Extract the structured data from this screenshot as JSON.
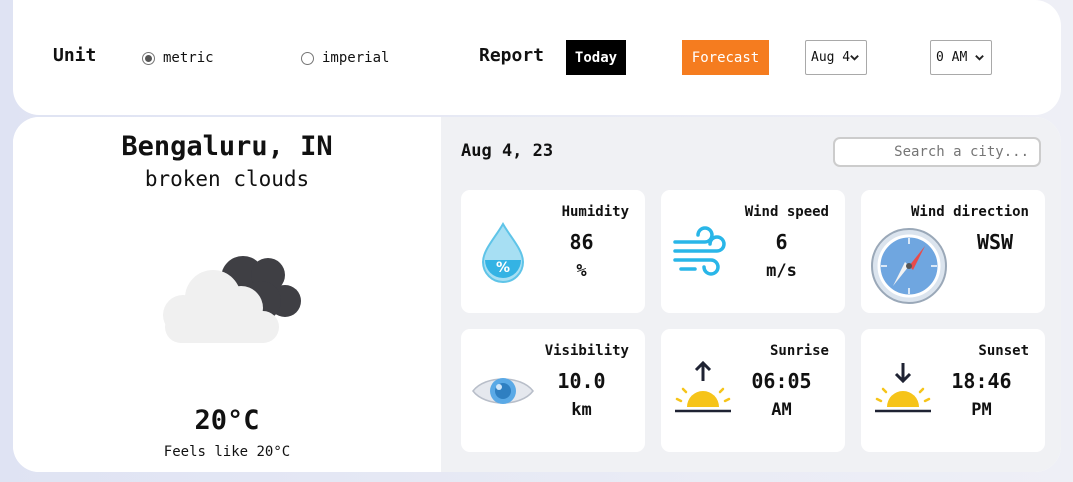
{
  "controls": {
    "unit_label": "Unit",
    "unit_options": [
      {
        "label": "metric",
        "checked": true
      },
      {
        "label": "imperial",
        "checked": false
      }
    ],
    "report_label": "Report",
    "today_label": "Today",
    "forecast_label": "Forecast",
    "date_select": "Aug 4",
    "hour_select": "0 AM"
  },
  "current": {
    "city": "Bengaluru, IN",
    "description": "broken clouds",
    "icon": "broken-clouds-icon",
    "temperature": "20°C",
    "feels_like": "Feels like 20°C"
  },
  "details": {
    "date": "Aug 4, 23",
    "search_placeholder": "Search a city...",
    "tiles": [
      {
        "title": "Humidity",
        "value": "86",
        "unit": "%",
        "icon": "humidity-drop-icon"
      },
      {
        "title": "Wind speed",
        "value": "6",
        "unit": "m/s",
        "icon": "wind-icon"
      },
      {
        "title": "Wind direction",
        "value": "WSW",
        "unit": "",
        "icon": "compass-icon"
      },
      {
        "title": "Visibility",
        "value": "10.0",
        "unit": "km",
        "icon": "eye-icon"
      },
      {
        "title": "Sunrise",
        "value": "06:05",
        "unit": "AM",
        "icon": "sunrise-icon"
      },
      {
        "title": "Sunset",
        "value": "18:46",
        "unit": "PM",
        "icon": "sunset-icon"
      }
    ]
  },
  "colors": {
    "forecast_button": "#f57c1f",
    "today_button": "#000000",
    "panel_background": "#f0f1f4"
  }
}
